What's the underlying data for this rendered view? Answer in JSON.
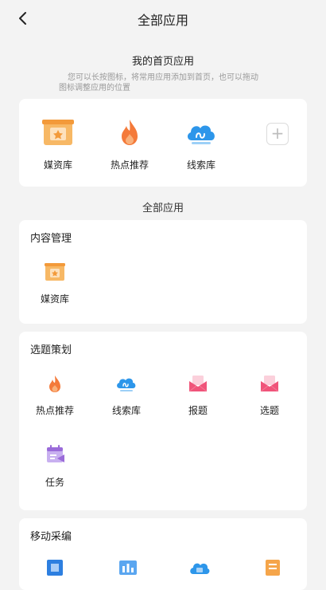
{
  "header": {
    "title": "全部应用"
  },
  "home": {
    "title": "我的首页应用",
    "description_line1": "您可以长按图标，将常用应用添加到首页，也可以拖动",
    "description_line2": "图标调整应用的位置",
    "apps": [
      {
        "label": "媒资库",
        "icon": "media-library-icon"
      },
      {
        "label": "热点推荐",
        "icon": "hot-recommend-icon"
      },
      {
        "label": "线索库",
        "icon": "clue-library-icon"
      }
    ],
    "add_label": "+"
  },
  "all_apps_label": "全部应用",
  "sections": [
    {
      "title": "内容管理",
      "apps": [
        {
          "label": "媒资库",
          "icon": "media-library-icon"
        }
      ]
    },
    {
      "title": "选题策划",
      "apps": [
        {
          "label": "热点推荐",
          "icon": "hot-recommend-icon"
        },
        {
          "label": "线索库",
          "icon": "clue-library-icon"
        },
        {
          "label": "报题",
          "icon": "report-topic-icon"
        },
        {
          "label": "选题",
          "icon": "select-topic-icon"
        },
        {
          "label": "任务",
          "icon": "task-icon"
        }
      ]
    },
    {
      "title": "移动采编",
      "apps": []
    }
  ],
  "colors": {
    "orange": "#f5a54a",
    "flame": "#f47a3a",
    "blue": "#2d96ea",
    "pink": "#f0547a",
    "purple": "#9a6bd9"
  }
}
